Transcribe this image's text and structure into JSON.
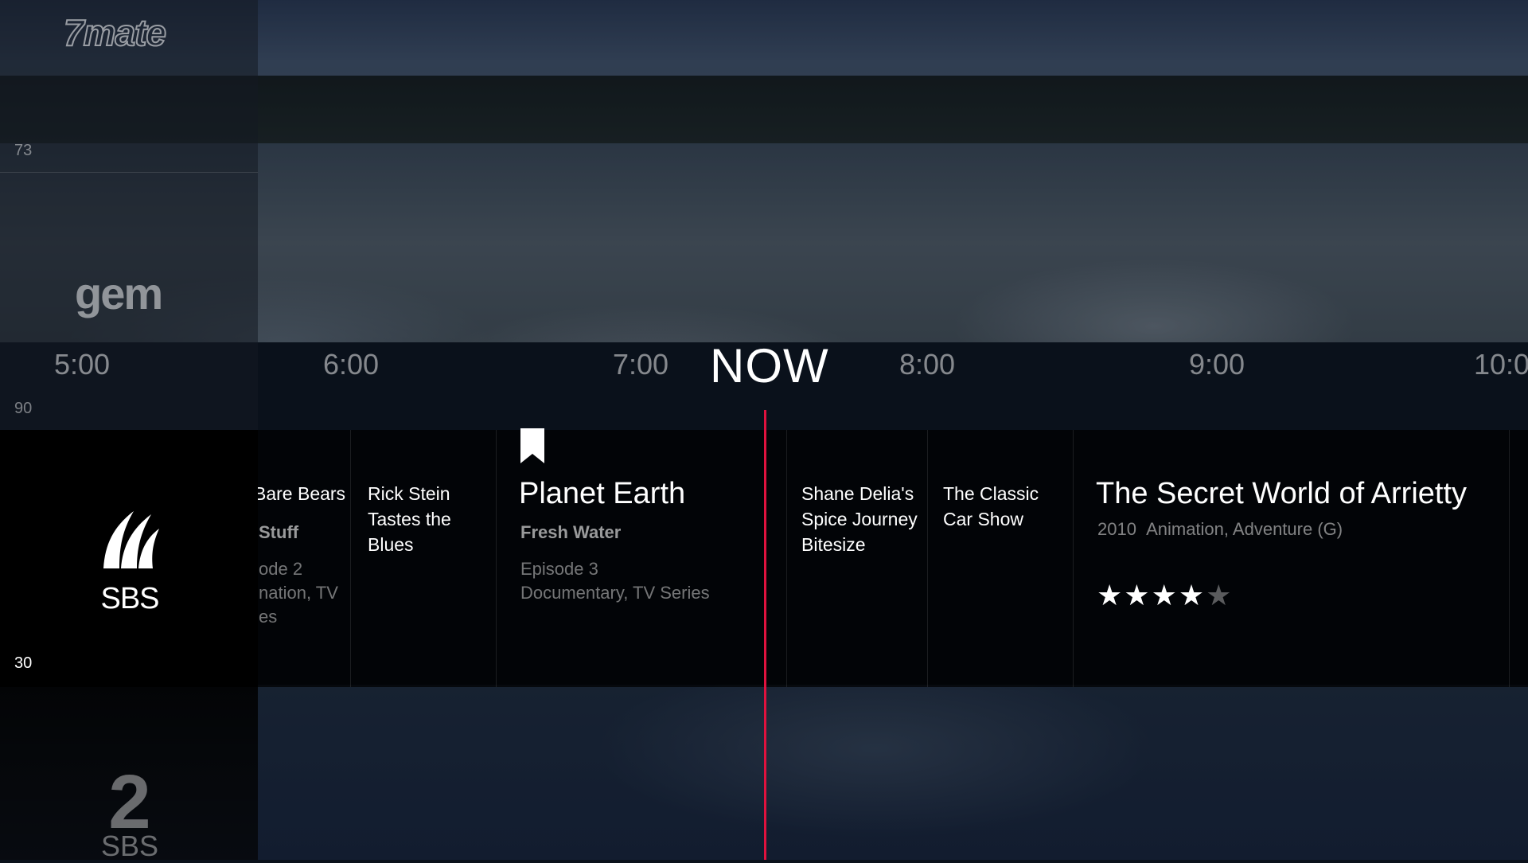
{
  "channels": {
    "above_top": {
      "logo": "7mate",
      "number": "73"
    },
    "above": {
      "logo": "gem",
      "number": "90"
    },
    "current": {
      "logo": "SBS",
      "number": "30"
    },
    "below": {
      "logo": "SBS",
      "logo_numeral": "2"
    }
  },
  "timeline": {
    "now_label": "NOW",
    "times": [
      "5:00",
      "6:00",
      "7:00",
      "8:00",
      "9:00",
      "10:0"
    ]
  },
  "programs": [
    {
      "title": "Bare Bears",
      "subtitle": "Stuff",
      "meta": "ode 2\nnation, TV\nes"
    },
    {
      "title": "Rick Stein Tastes the Blues"
    },
    {
      "title": "Planet Earth",
      "subtitle": "Fresh Water",
      "episode": "Episode 3",
      "genre": "Documentary, TV Series",
      "bookmarked": true
    },
    {
      "title": "Shane Delia's Spice Journey Bitesize"
    },
    {
      "title": "The Classic Car Show"
    },
    {
      "title": "The Secret World of Arrietty",
      "year": "2010",
      "genre": "Animation, Adventure (G)",
      "rating": 4,
      "rating_max": 5
    }
  ],
  "colors": {
    "now_line": "#e0123e",
    "row_background": "#000000"
  },
  "icons": {
    "bookmark": "bookmark-icon",
    "star": "star-icon"
  }
}
